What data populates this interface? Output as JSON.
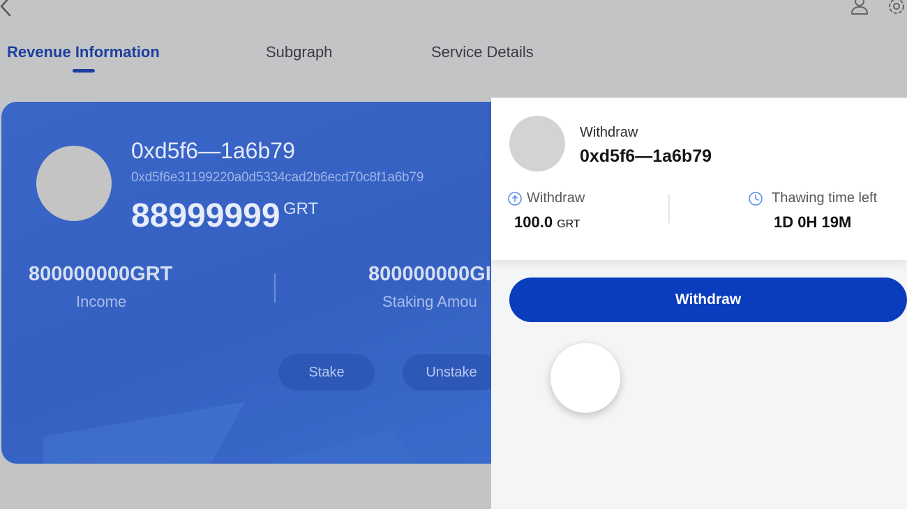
{
  "tabs": [
    {
      "label": "Revenue Information",
      "active": true
    },
    {
      "label": "Subgraph",
      "active": false
    },
    {
      "label": "Service Details",
      "active": false
    }
  ],
  "card": {
    "short_address": "0xd5f6—1a6b79",
    "full_address": "0xd5f6e31199220a0d5334cad2b6ecd70c8f1a6b79",
    "amount": "88999999",
    "amount_unit": "GRT",
    "stats": [
      {
        "value": "800000000GRT",
        "label": "Income"
      },
      {
        "value": "800000000GI",
        "label": "Staking Amou"
      }
    ],
    "buttons": {
      "stake": "Stake",
      "unstake": "Unstake"
    }
  },
  "panel": {
    "title": "Withdraw",
    "address": "0xd5f6—1a6b79",
    "withdraw_label": "Withdraw",
    "withdraw_value": "100.0",
    "withdraw_unit": "GRT",
    "thawing_label": "Thawing time left",
    "thawing_value": "1D 0H 19M",
    "button_label": "Withdraw"
  },
  "colors": {
    "accent": "#1c3f9e",
    "card_blue": "#3560c2",
    "button_blue": "#0a3cbe",
    "info_icon": "#5b8ee6"
  },
  "icons": [
    "back-icon",
    "user-icon",
    "gear-icon",
    "upload-circle-icon",
    "clock-icon"
  ]
}
